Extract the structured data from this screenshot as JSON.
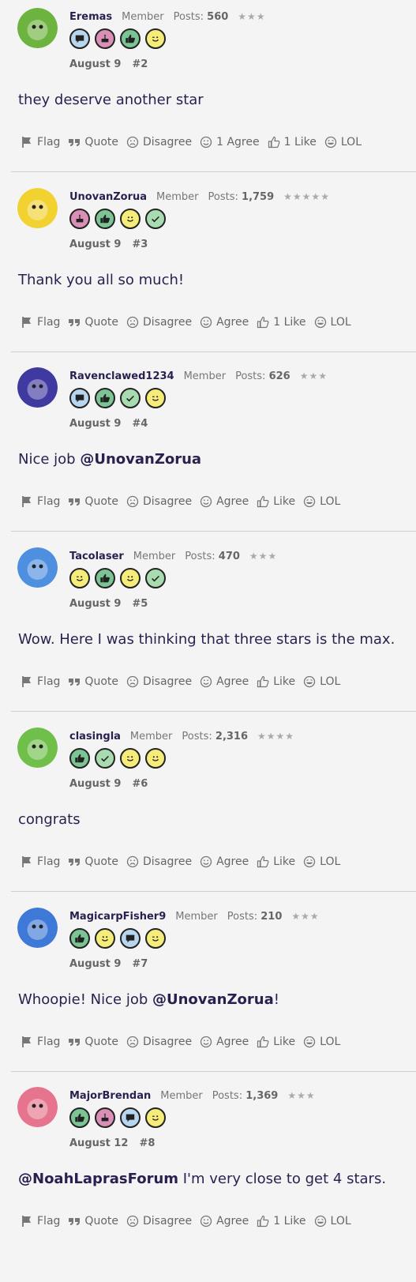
{
  "stars": {
    "3": "★★★",
    "4": "★★★★",
    "5": "★★★★★"
  },
  "posts": [
    {
      "username": "Eremas",
      "role": "Member",
      "posts_label": "Posts:",
      "posts_count": "560",
      "stars": "★★★",
      "badges": [
        "chat-icon",
        "cake-icon",
        "thumbs-up-icon",
        "wink-icon"
      ],
      "date": "August 9",
      "number": "#2",
      "message": [
        {
          "text": "they deserve another star"
        }
      ],
      "actions": [
        "Flag",
        "Quote",
        "Disagree",
        "1 Agree",
        "1 Like",
        "LOL"
      ],
      "avatar_color": "#6db33f"
    },
    {
      "username": "UnovanZorua",
      "role": "Member",
      "posts_label": "Posts:",
      "posts_count": "1,759",
      "stars": "★★★★★",
      "badges": [
        "cake-icon",
        "thumbs-up-icon",
        "smile-icon",
        "check-icon"
      ],
      "date": "August 9",
      "number": "#3",
      "message": [
        {
          "text": "Thank you all so much!"
        }
      ],
      "actions": [
        "Flag",
        "Quote",
        "Disagree",
        "Agree",
        "1 Like",
        "LOL"
      ],
      "avatar_color": "#f2d230"
    },
    {
      "username": "Ravenclawed1234",
      "role": "Member",
      "posts_label": "Posts:",
      "posts_count": "626",
      "stars": "★★★",
      "badges": [
        "chat-icon",
        "thumbs-up-icon",
        "check-icon",
        "wink-icon"
      ],
      "date": "August 9",
      "number": "#4",
      "message": [
        {
          "text": "Nice job "
        },
        {
          "text": "@UnovanZorua",
          "mention": true
        }
      ],
      "actions": [
        "Flag",
        "Quote",
        "Disagree",
        "Agree",
        "Like",
        "LOL"
      ],
      "avatar_color": "#3f3aa0"
    },
    {
      "username": "Tacolaser",
      "role": "Member",
      "posts_label": "Posts:",
      "posts_count": "470",
      "stars": "★★★",
      "badges": [
        "wink-icon",
        "thumbs-up-icon",
        "smile-icon",
        "check-icon"
      ],
      "date": "August 9",
      "number": "#5",
      "message": [
        {
          "text": "Wow. Here I was thinking that three stars is the max."
        }
      ],
      "actions": [
        "Flag",
        "Quote",
        "Disagree",
        "Agree",
        "Like",
        "LOL"
      ],
      "avatar_color": "#4f8fe0"
    },
    {
      "username": "clasingla",
      "role": "Member",
      "posts_label": "Posts:",
      "posts_count": "2,316",
      "stars": "★★★★",
      "badges": [
        "thumbs-up-icon",
        "check-icon",
        "wink-icon",
        "smile-icon"
      ],
      "date": "August 9",
      "number": "#6",
      "message": [
        {
          "text": "congrats"
        }
      ],
      "actions": [
        "Flag",
        "Quote",
        "Disagree",
        "Agree",
        "Like",
        "LOL"
      ],
      "avatar_color": "#6fbf4a"
    },
    {
      "username": "MagicarpFisher9",
      "role": "Member",
      "posts_label": "Posts:",
      "posts_count": "210",
      "stars": "★★★",
      "badges": [
        "thumbs-up-icon",
        "smile-icon",
        "chat-icon",
        "wink-icon"
      ],
      "date": "August 9",
      "number": "#7",
      "message": [
        {
          "text": "Whoopie! Nice job "
        },
        {
          "text": "@UnovanZorua",
          "mention": true
        },
        {
          "text": "!"
        }
      ],
      "actions": [
        "Flag",
        "Quote",
        "Disagree",
        "Agree",
        "Like",
        "LOL"
      ],
      "avatar_color": "#3f79d8"
    },
    {
      "username": "MajorBrendan",
      "role": "Member",
      "posts_label": "Posts:",
      "posts_count": "1,369",
      "stars": "★★★",
      "badges": [
        "thumbs-up-icon",
        "cake-icon",
        "chat-icon",
        "wink-icon"
      ],
      "date": "August 12",
      "number": "#8",
      "message": [
        {
          "text": "@NoahLaprasForum",
          "mention": true
        },
        {
          "text": " I'm very close to get 4 stars."
        }
      ],
      "actions": [
        "Flag",
        "Quote",
        "Disagree",
        "Agree",
        "1 Like",
        "LOL"
      ],
      "avatar_color": "#e6748f"
    }
  ]
}
